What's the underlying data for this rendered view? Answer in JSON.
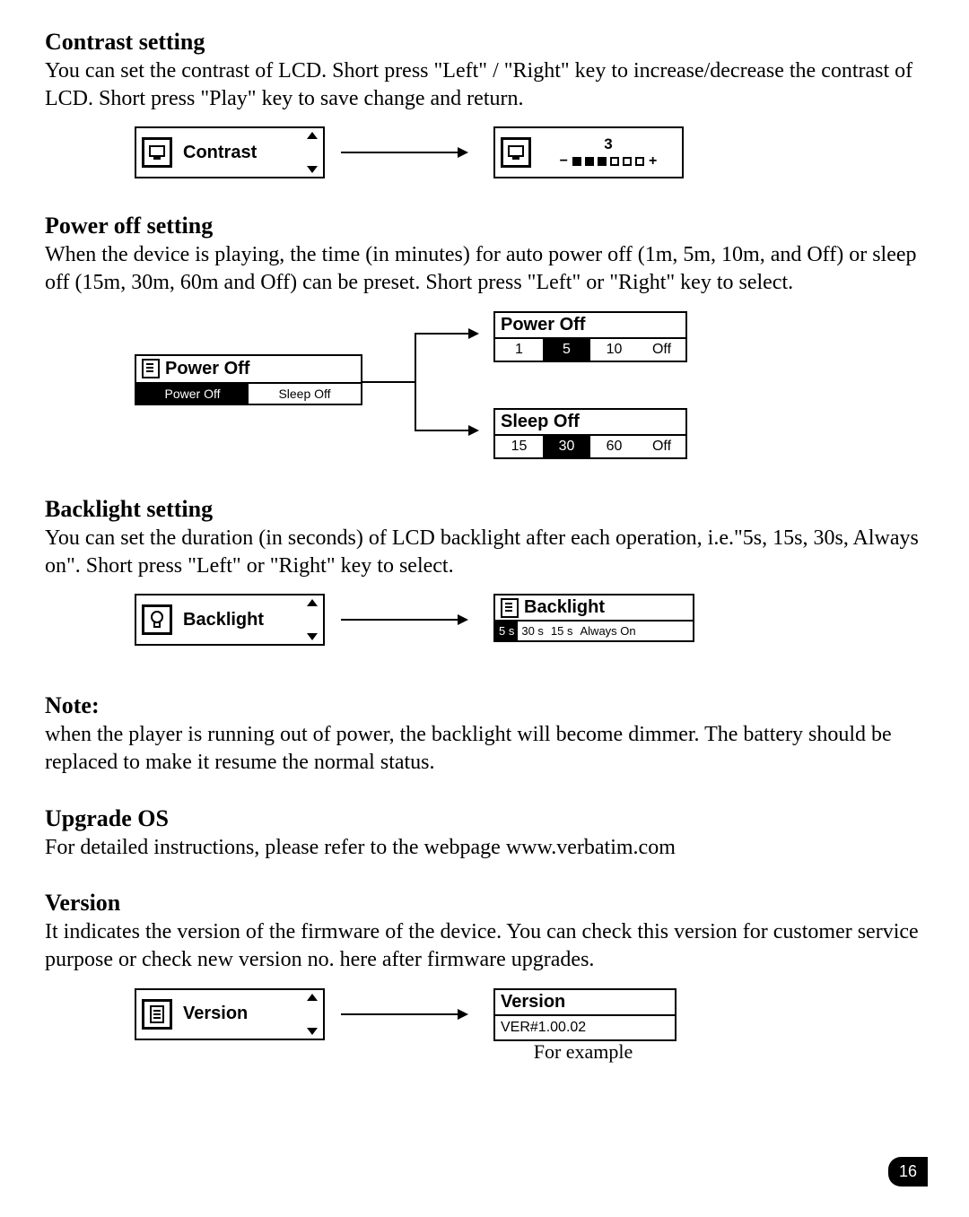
{
  "page_number": "16",
  "contrast": {
    "heading": "Contrast setting",
    "body": "You can set the contrast of LCD. Short press \"Left\" / \"Right\" key to increase/decrease the contrast of LCD. Short press \"Play\" key to save change and return.",
    "lcd_label": "Contrast",
    "value": "3",
    "minus": "−",
    "plus": "+",
    "filled": 3,
    "total": 6
  },
  "poweroff": {
    "heading": "Power off setting",
    "body": "When the device is playing, the time (in minutes) for auto power off (1m, 5m, 10m, and Off) or sleep off (15m, 30m, 60m and Off) can be preset. Short press \"Left\" or \"Right\" key to select.",
    "menu_title": "Power Off",
    "tab_power": "Power Off",
    "tab_sleep": "Sleep Off",
    "panel_power_title": "Power Off",
    "panel_power_opts": [
      "1",
      "5",
      "10",
      "Off"
    ],
    "panel_power_sel": "5",
    "panel_sleep_title": "Sleep Off",
    "panel_sleep_opts": [
      "15",
      "30",
      "60",
      "Off"
    ],
    "panel_sleep_sel": "30"
  },
  "backlight": {
    "heading": "Backlight setting",
    "body": "You can set the duration (in seconds) of LCD backlight after each operation, i.e.\"5s, 15s, 30s, Always on\". Short press \"Left\" or \"Right\" key to select.",
    "lcd_label": "Backlight",
    "panel_title": "Backlight",
    "opts": [
      "5 s",
      "30 s",
      "15 s",
      "Always On"
    ],
    "sel": "5 s"
  },
  "note": {
    "heading": "Note:",
    "body": "when the player is running out of power, the backlight will become dimmer. The battery should be replaced to make it resume the normal status."
  },
  "upgrade": {
    "heading": "Upgrade OS",
    "body": "For detailed instructions, please refer to the webpage www.verbatim.com"
  },
  "version": {
    "heading": "Version",
    "body": "It indicates the version of the firmware of the device. You can check this version for customer service purpose or check new version no. here after firmware upgrades.",
    "lcd_label": "Version",
    "panel_title": "Version",
    "panel_value": "VER#1.00.02",
    "caption": "For example"
  }
}
